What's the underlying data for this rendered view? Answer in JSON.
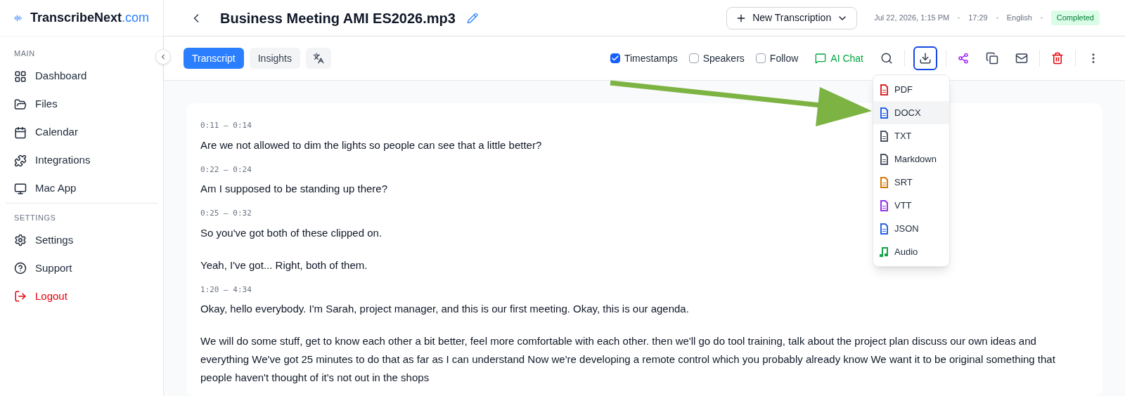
{
  "brand": {
    "name": "TranscribeNext",
    "suffix": ".com"
  },
  "sidebar": {
    "sections": [
      {
        "title": "MAIN",
        "items": [
          {
            "label": "Dashboard",
            "kind": "link"
          },
          {
            "label": "Files",
            "kind": "link"
          },
          {
            "label": "Calendar",
            "kind": "link"
          },
          {
            "label": "Integrations",
            "kind": "link"
          },
          {
            "label": "Mac App",
            "kind": "link"
          }
        ]
      },
      {
        "title": "SETTINGS",
        "items": [
          {
            "label": "Settings",
            "kind": "link"
          },
          {
            "label": "Support",
            "kind": "link"
          },
          {
            "label": "Logout",
            "kind": "danger"
          }
        ]
      }
    ]
  },
  "header": {
    "title": "Business Meeting AMI ES2026.mp3",
    "new_button": "New Transcription",
    "date": "Jul 22, 2026, 1:15 PM",
    "duration": "17:29",
    "language": "English",
    "status": "Completed"
  },
  "tabs": [
    {
      "label": "Transcript",
      "selected": true
    },
    {
      "label": "Insights",
      "selected": false
    }
  ],
  "options": [
    {
      "label": "Timestamps",
      "checked": true
    },
    {
      "label": "Speakers",
      "checked": false
    },
    {
      "label": "Follow",
      "checked": false
    }
  ],
  "ai_chat": "AI Chat",
  "export_menu": {
    "open": true,
    "items": [
      {
        "label": "PDF",
        "kind": "file",
        "color": "#dc2626",
        "selected": false
      },
      {
        "label": "DOCX",
        "kind": "file",
        "color": "#2563eb",
        "selected": true
      },
      {
        "label": "TXT",
        "kind": "file",
        "color": "#4b5563",
        "selected": false
      },
      {
        "label": "Markdown",
        "kind": "file",
        "color": "#4b5563",
        "selected": false
      },
      {
        "label": "SRT",
        "kind": "file",
        "color": "#d97706",
        "selected": false
      },
      {
        "label": "VTT",
        "kind": "file",
        "color": "#9333ea",
        "selected": false
      },
      {
        "label": "JSON",
        "kind": "file",
        "color": "#2563eb",
        "selected": false
      },
      {
        "label": "Audio",
        "kind": "audio",
        "color": "#16a34a",
        "selected": false
      }
    ]
  },
  "segments": [
    {
      "time": "0:11 – 0:14",
      "paragraphs": [
        "Are we not allowed to dim the lights so people can see that a little better?"
      ]
    },
    {
      "time": "0:22 – 0:24",
      "paragraphs": [
        "Am I supposed to be standing up there?"
      ]
    },
    {
      "time": "0:25 – 0:32",
      "paragraphs": [
        "So you've got both of these clipped on.",
        "Yeah, I've got... Right, both of them."
      ]
    },
    {
      "time": "1:20 – 4:34",
      "paragraphs": [
        "Okay, hello everybody. I'm Sarah, project manager, and this is our first meeting. Okay, this is our agenda.",
        "We will do some stuff, get to know each other a bit better, feel more comfortable with each other. then we'll go do tool training, talk about the project plan discuss our own ideas and everything We've got 25 minutes to do that as far as I can understand Now we're developing a remote control which you probably already know We want it to be original something that people haven't thought of it's not out in the shops"
      ]
    }
  ]
}
